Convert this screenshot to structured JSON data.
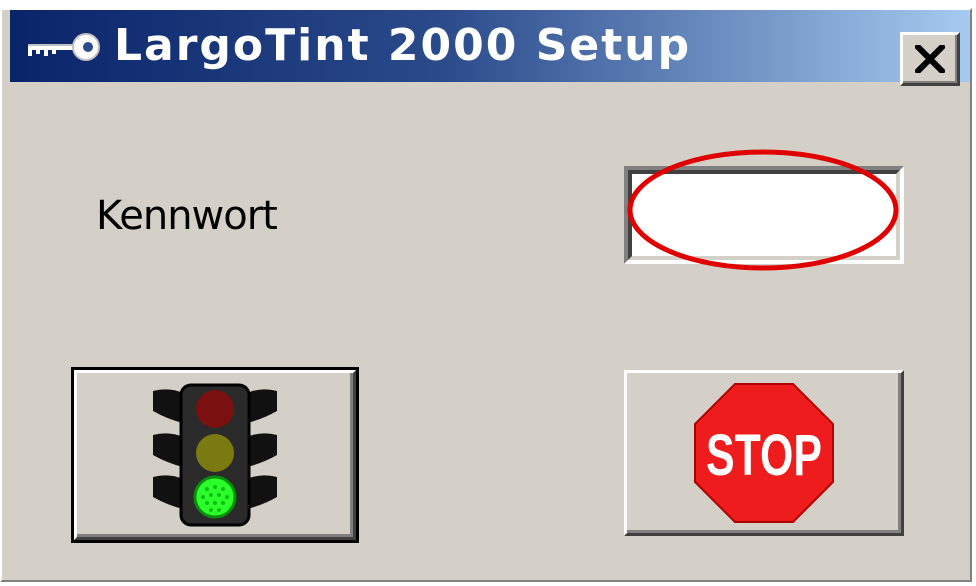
{
  "window": {
    "title": "LargoTint 2000 Setup",
    "title_icon": "key-icon"
  },
  "titlebar": {
    "close_icon": "close-icon",
    "close_glyph": "X"
  },
  "form": {
    "password_label": "Kennwort",
    "password_value": "",
    "password_placeholder": ""
  },
  "buttons": {
    "go_icon": "traffic-light-icon",
    "stop_icon": "stop-sign-icon",
    "stop_text": "STOP"
  },
  "colors": {
    "titlebar_start": "#0a246a",
    "titlebar_end": "#a6caf0",
    "face": "#d4d0c8",
    "annotation": "#e00000",
    "stop_red": "#ee1c1c",
    "light_red": "#7a1010",
    "light_yellow": "#7a7a10",
    "light_green": "#2bff2b"
  }
}
